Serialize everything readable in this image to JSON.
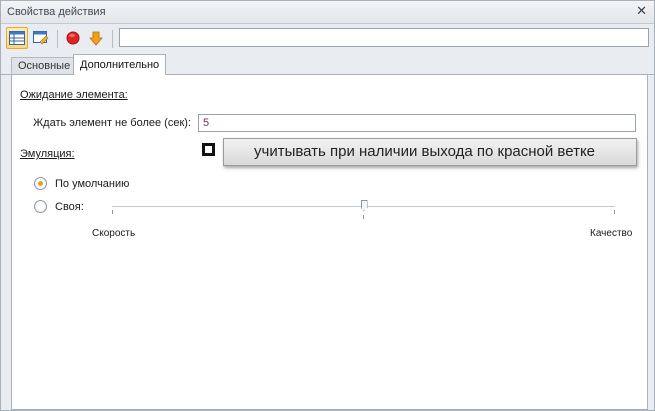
{
  "window": {
    "title": "Свойства действия",
    "close_glyph": "✕"
  },
  "toolbar": {
    "buttons": [
      {
        "icon": "grid-view-icon"
      },
      {
        "icon": "edit-window-icon"
      },
      {
        "icon": "red-circle-icon"
      },
      {
        "icon": "down-arrow-icon"
      }
    ],
    "input_value": ""
  },
  "tabs": [
    {
      "label": "Основные",
      "active": false
    },
    {
      "label": "Дополнительно",
      "active": true
    }
  ],
  "content": {
    "wait_section": {
      "heading": "Ожидание элемента:",
      "field_label": "Ждать элемент не более (сек):",
      "field_value": "5"
    },
    "emulation": {
      "heading": "Эмуляция:",
      "tooltip": "учитывать при наличии выхода по красной ветке",
      "options": [
        {
          "label": "По умолчанию",
          "checked": true
        },
        {
          "label": "Своя:",
          "checked": false
        }
      ],
      "slider": {
        "min_label": "Скорость",
        "max_label": "Качество",
        "value_fraction": 0.5
      }
    }
  },
  "colors": {
    "accent": "#e7a21c",
    "record": "#e02424",
    "arrow": "#f2a01c",
    "input_text": "#7a2f6e"
  }
}
